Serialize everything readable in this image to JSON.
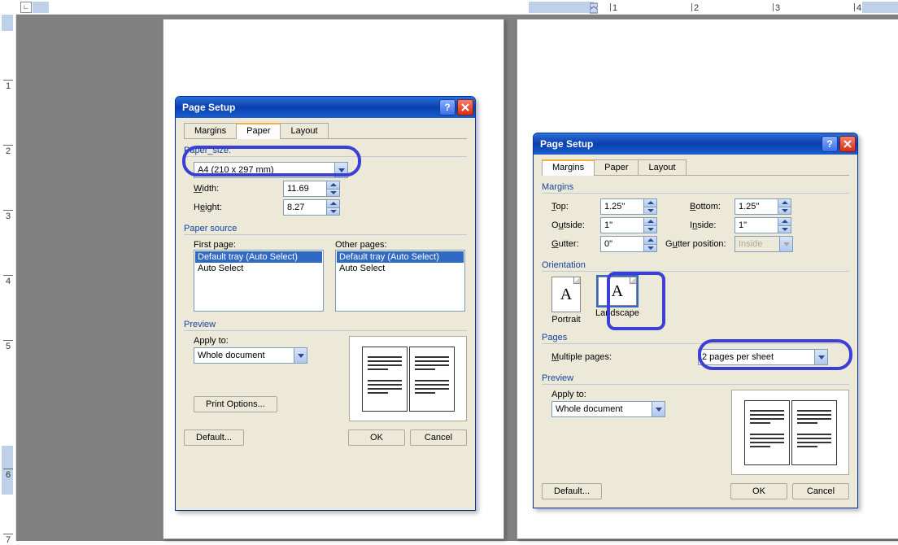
{
  "ruler": {
    "nums_h": [
      "1",
      "2",
      "3",
      "4"
    ],
    "nums_v": [
      "1",
      "2",
      "3",
      "4",
      "5",
      "6",
      "7"
    ]
  },
  "dialog1": {
    "title": "Page Setup",
    "tabs": {
      "margins": "Margins",
      "paper": "Paper",
      "layout": "Layout"
    },
    "paper": {
      "group_size": "Paper_size:",
      "size_value": "A4 (210 x 297 mm)",
      "width_label": "Width:",
      "width_value": "11.69",
      "height_label": "Height:",
      "height_value": "8.27",
      "group_source": "Paper source",
      "first_label": "First page:",
      "other_label": "Other pages:",
      "tray_default": "Default tray (Auto Select)",
      "tray_auto": "Auto Select",
      "group_preview": "Preview",
      "apply_label": "Apply to:",
      "apply_value": "Whole document",
      "print_options": "Print Options..."
    },
    "buttons": {
      "default": "Default...",
      "ok": "OK",
      "cancel": "Cancel"
    }
  },
  "dialog2": {
    "title": "Page Setup",
    "tabs": {
      "margins": "Margins",
      "paper": "Paper",
      "layout": "Layout"
    },
    "margins": {
      "group_margins": "Margins",
      "top_label": "Top:",
      "top_value": "1.25\"",
      "bottom_label": "Bottom:",
      "bottom_value": "1.25\"",
      "outside_label": "Outside:",
      "outside_value": "1\"",
      "inside_label": "Inside:",
      "inside_value": "1\"",
      "gutter_label": "Gutter:",
      "gutter_value": "0\"",
      "gutter_pos_label": "Gutter position:",
      "gutter_pos_value": "Inside",
      "group_orientation": "Orientation",
      "portrait": "Portrait",
      "landscape": "Landscape",
      "group_pages": "Pages",
      "multi_label": "Multiple pages:",
      "multi_value": "2 pages per sheet",
      "group_preview": "Preview",
      "apply_label": "Apply to:",
      "apply_value": "Whole document"
    },
    "buttons": {
      "default": "Default...",
      "ok": "OK",
      "cancel": "Cancel"
    }
  }
}
